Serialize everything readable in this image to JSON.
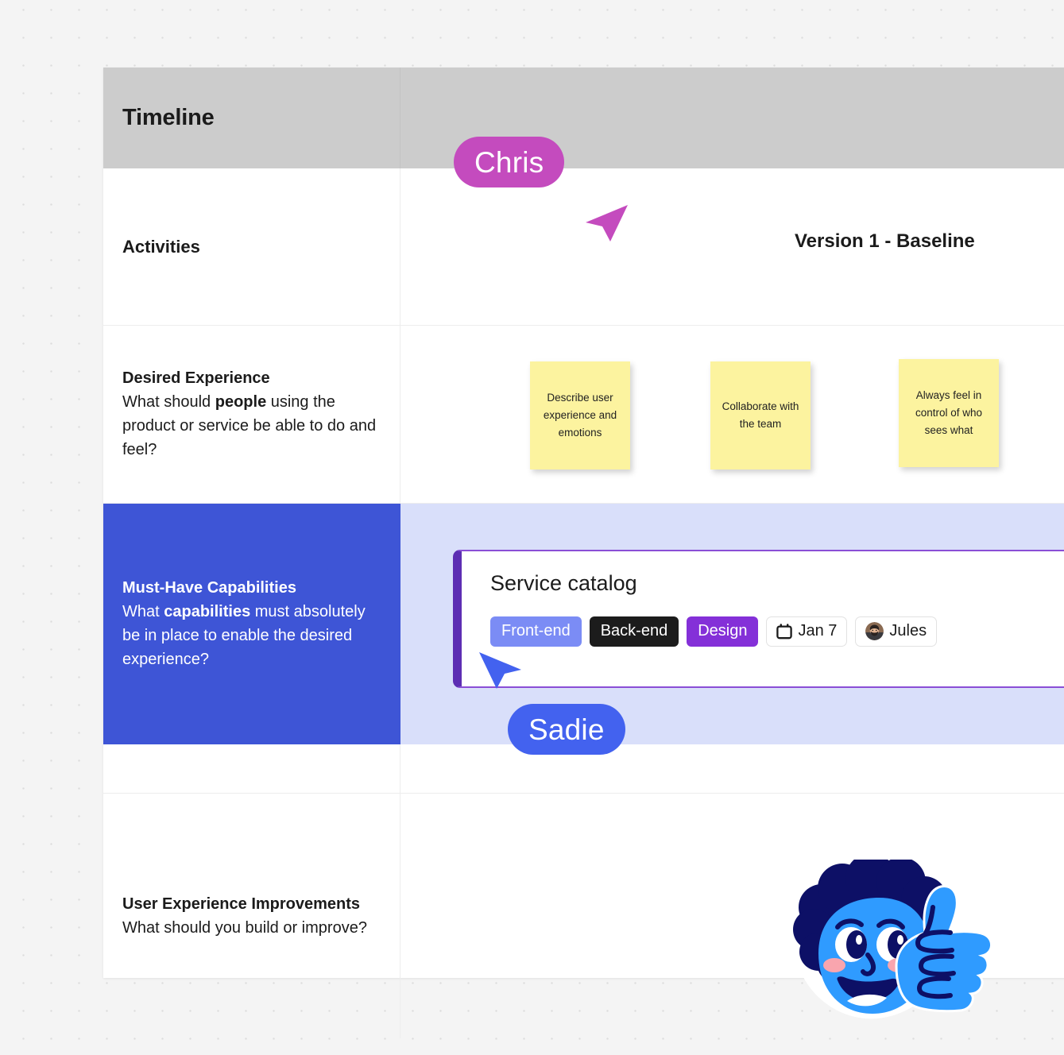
{
  "canvas": {
    "background_color": "#f4f4f4",
    "dot_color": "#dcdcdc"
  },
  "board": {
    "header": {
      "timeline_label": "Timeline",
      "background_color": "#cccccc"
    },
    "rows": [
      {
        "id": "activities",
        "title": "Activities",
        "version_header": "Version 1 - Baseline"
      },
      {
        "id": "desired-experience",
        "title": "Desired Experience",
        "description_pre": "What should ",
        "description_bold": "people",
        "description_post": " using the product or service be able to do and feel?",
        "stickies": [
          {
            "text": "Describe  user experience and emotions"
          },
          {
            "text": "Collaborate with the team"
          },
          {
            "text": "Always feel in control of who sees what"
          }
        ],
        "sticky_color": "#fcf39f"
      },
      {
        "id": "must-have-capabilities",
        "title": "Must-Have Capabilities",
        "description_pre": "What ",
        "description_bold": "capabilities",
        "description_post": " must absolutely be in place to enable the desired experience?",
        "highlight_label_color": "#3e55d6",
        "highlight_content_color": "#d9dffa"
      },
      {
        "id": "user-experience-improvements",
        "title": "User Experience Improvements",
        "description_pre": "What should you build or improve?",
        "description_bold": "",
        "description_post": ""
      }
    ]
  },
  "card": {
    "title": "Service catalog",
    "accent_color": "#5d2eb3",
    "border_color": "#8a4ed6",
    "tags": [
      {
        "label": "Front-end",
        "color": "#7b8cf5"
      },
      {
        "label": "Back-end",
        "color": "#1c1c1c"
      },
      {
        "label": "Design",
        "color": "#8430d8"
      }
    ],
    "date_chip": {
      "icon": "calendar-icon",
      "label": "Jan 7"
    },
    "assignee_chip": {
      "icon": "avatar",
      "label": "Jules"
    }
  },
  "cursors": [
    {
      "name": "Chris",
      "color": "#c44bbe"
    },
    {
      "name": "Sadie",
      "color": "#4362ef"
    }
  ],
  "mascot": {
    "name": "thumbs-up-character",
    "skin_color": "#2f9bff",
    "hair_color": "#0d1066"
  }
}
